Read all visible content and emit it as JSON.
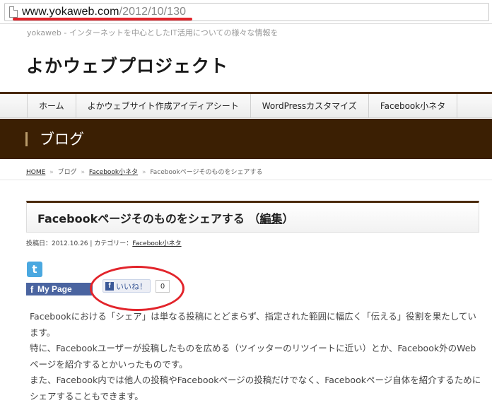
{
  "browser": {
    "url_host": "www.yokaweb.com",
    "url_path": "/2012/10/130",
    "page_icon": "page-icon"
  },
  "site": {
    "tagline": "yokaweb - インターネットを中心としたIT活用についての様々な情報を",
    "title": "よかウェブプロジェクト"
  },
  "nav": {
    "items": [
      {
        "label": "ホーム"
      },
      {
        "label": "よかウェブサイト作成アイディアシート"
      },
      {
        "label": "WordPressカスタマイズ"
      },
      {
        "label": "Facebook小ネタ"
      }
    ]
  },
  "banner": {
    "title": "ブログ"
  },
  "breadcrumb": {
    "home": "HOME",
    "sep": "»",
    "blog": "ブログ",
    "category": "Facebook小ネタ",
    "current": "Facebookページそのものをシェアする"
  },
  "post": {
    "title": "Facebookページそのものをシェアする",
    "edit_open": "（",
    "edit_label": "編集",
    "edit_close": "）",
    "meta_prefix": "投稿日：2012.10.26 | カテゴリー：",
    "meta_category": "Facebook小ネタ",
    "paragraphs": [
      "Facebookにおける「シェア」は単なる投稿にとどまらず、指定された範囲に幅広く「伝える」役割を果たしています。",
      "特に、Facebookユーザーが投稿したものを広める（ツイッターのリツイートに近い）とか、Facebook外のWebページを紹介するとかいったものです。",
      "また、Facebook内では他人の投稿やFacebookページの投稿だけでなく、Facebookページ自体を紹介するためにシェアすることもできます。"
    ]
  },
  "social": {
    "twitter_icon": "twitter-icon",
    "twitter_glyph": "t",
    "mypage_glyph": "f",
    "mypage_label": "My Page",
    "like_glyph": "f",
    "like_label": "いいね！",
    "like_count": "0"
  },
  "colors": {
    "header_brown": "#3b1f03",
    "annotation_red": "#e2242b",
    "facebook_blue": "#3b5998"
  }
}
